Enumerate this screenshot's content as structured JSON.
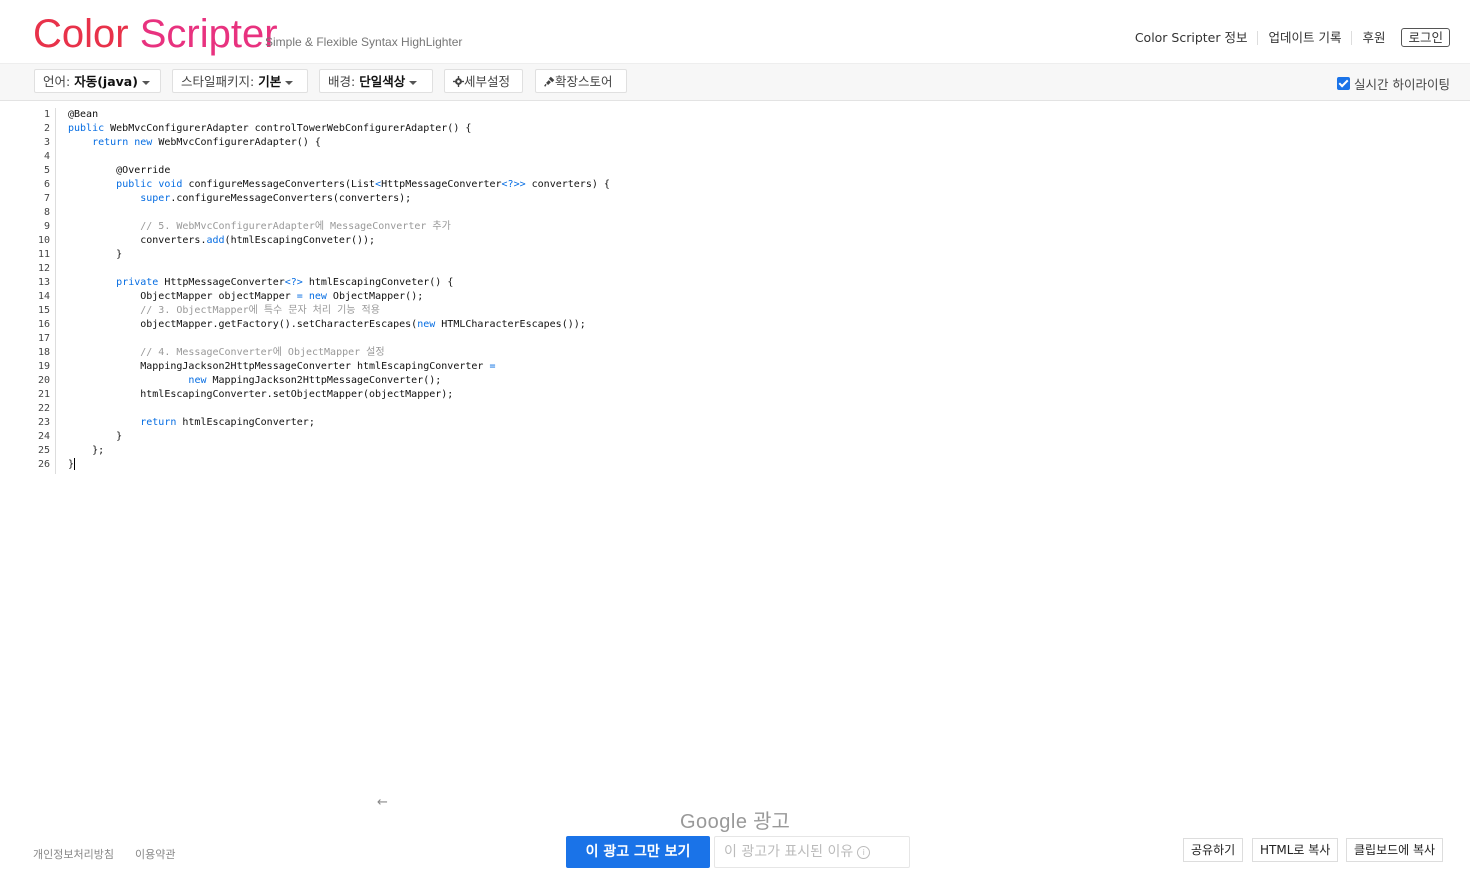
{
  "header": {
    "logo_part1": "Color ",
    "logo_part2": "Scripter",
    "tagline": "Simple & Flexible Syntax HighLighter",
    "nav": [
      "Color Scripter 정보",
      "업데이트 기록",
      "후원"
    ],
    "login": "로그인"
  },
  "toolbar": {
    "language_label": "언어:",
    "language_value": "자동(java)",
    "style_label": "스타일패키지:",
    "style_value": "기본",
    "background_label": "배경:",
    "background_value": "단일색상",
    "settings": "세부설정",
    "extension_store": "확장스토어",
    "realtime_label": "실시간 하이라이팅",
    "realtime_checked": true
  },
  "editor": {
    "line_numbers": [
      "1",
      "2",
      "3",
      "4",
      "5",
      "6",
      "7",
      "8",
      "9",
      "10",
      "11",
      "12",
      "13",
      "14",
      "15",
      "16",
      "17",
      "18",
      "19",
      "20",
      "21",
      "22",
      "23",
      "24",
      "25",
      "26"
    ],
    "lines": [
      [
        {
          "t": "@Bean",
          "c": ""
        }
      ],
      [
        {
          "t": "public",
          "c": "kw"
        },
        {
          "t": " WebMvcConfigurerAdapter controlTowerWebConfigurerAdapter() {",
          "c": ""
        }
      ],
      [
        {
          "t": "    ",
          "c": ""
        },
        {
          "t": "return",
          "c": "kw"
        },
        {
          "t": " ",
          "c": ""
        },
        {
          "t": "new",
          "c": "kw"
        },
        {
          "t": " WebMvcConfigurerAdapter() {",
          "c": ""
        }
      ],
      [],
      [
        {
          "t": "        @Override",
          "c": ""
        }
      ],
      [
        {
          "t": "        ",
          "c": ""
        },
        {
          "t": "public",
          "c": "kw"
        },
        {
          "t": " ",
          "c": ""
        },
        {
          "t": "void",
          "c": "kw"
        },
        {
          "t": " configureMessageConverters(List",
          "c": ""
        },
        {
          "t": "<",
          "c": "kw"
        },
        {
          "t": "HttpMessageConverter",
          "c": ""
        },
        {
          "t": "<?>>",
          "c": "kw"
        },
        {
          "t": " converters) {",
          "c": ""
        }
      ],
      [
        {
          "t": "            ",
          "c": ""
        },
        {
          "t": "super",
          "c": "kw"
        },
        {
          "t": ".configureMessageConverters(converters);",
          "c": ""
        }
      ],
      [],
      [
        {
          "t": "            // 5. WebMvcConfigurerAdapter에 MessageConverter 추가",
          "c": "cm"
        }
      ],
      [
        {
          "t": "            converters.",
          "c": ""
        },
        {
          "t": "add",
          "c": "kw"
        },
        {
          "t": "(htmlEscapingConveter());",
          "c": ""
        }
      ],
      [
        {
          "t": "        }",
          "c": ""
        }
      ],
      [],
      [
        {
          "t": "        ",
          "c": ""
        },
        {
          "t": "private",
          "c": "kw"
        },
        {
          "t": " HttpMessageConverter",
          "c": ""
        },
        {
          "t": "<?>",
          "c": "kw"
        },
        {
          "t": " htmlEscapingConveter() {",
          "c": ""
        }
      ],
      [
        {
          "t": "            ObjectMapper objectMapper ",
          "c": ""
        },
        {
          "t": "=",
          "c": "kw"
        },
        {
          "t": " ",
          "c": ""
        },
        {
          "t": "new",
          "c": "kw"
        },
        {
          "t": " ObjectMapper();",
          "c": ""
        }
      ],
      [
        {
          "t": "            // 3. ObjectMapper에 특수 문자 처리 기능 적용",
          "c": "cm"
        }
      ],
      [
        {
          "t": "            objectMapper.getFactory().setCharacterEscapes(",
          "c": ""
        },
        {
          "t": "new",
          "c": "kw"
        },
        {
          "t": " HTMLCharacterEscapes());",
          "c": ""
        }
      ],
      [],
      [
        {
          "t": "            // 4. MessageConverter에 ObjectMapper 설정",
          "c": "cm"
        }
      ],
      [
        {
          "t": "            MappingJackson2HttpMessageConverter htmlEscapingConverter ",
          "c": ""
        },
        {
          "t": "=",
          "c": "kw"
        }
      ],
      [
        {
          "t": "                    ",
          "c": ""
        },
        {
          "t": "new",
          "c": "kw"
        },
        {
          "t": " MappingJackson2HttpMessageConverter();",
          "c": ""
        }
      ],
      [
        {
          "t": "            htmlEscapingConverter.setObjectMapper(objectMapper);",
          "c": ""
        }
      ],
      [],
      [
        {
          "t": "            ",
          "c": ""
        },
        {
          "t": "return",
          "c": "kw"
        },
        {
          "t": " htmlEscapingConverter;",
          "c": ""
        }
      ],
      [
        {
          "t": "        }",
          "c": ""
        }
      ],
      [
        {
          "t": "    };",
          "c": ""
        }
      ],
      [
        {
          "t": "}",
          "c": ""
        }
      ]
    ]
  },
  "ad": {
    "brand_google": "Google",
    "brand_ad": "광고",
    "stop_button": "이 광고 그만 보기",
    "why_button": "이 광고가 표시된 이유",
    "back_arrow": "←",
    "info_glyph": "i"
  },
  "footer": {
    "privacy": "개인정보처리방침",
    "terms": "이용약관",
    "share": "공유하기",
    "copy_html": "HTML로 복사",
    "copy_clipboard": "클립보드에 복사"
  }
}
